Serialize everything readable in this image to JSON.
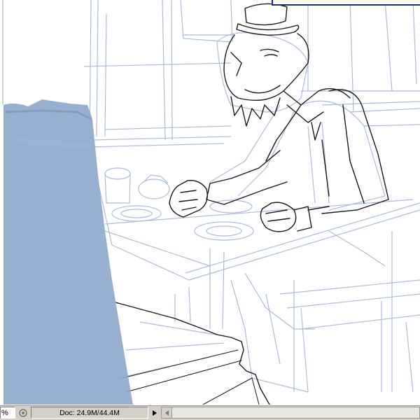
{
  "canvas": {
    "description_icon": "pencil-sketch-artwork",
    "colors": {
      "sketch_line": "#8fa7cc",
      "ink_line": "#111111",
      "fill_blue": "#8ea9cc",
      "frame_border": "#1a2a8c"
    }
  },
  "statusbar": {
    "zoom": "%",
    "doc_info": "Doc: 24.9M/44.4M",
    "sync_icon": "sync-circle-icon",
    "menu_icon": "play-triangle-icon"
  }
}
